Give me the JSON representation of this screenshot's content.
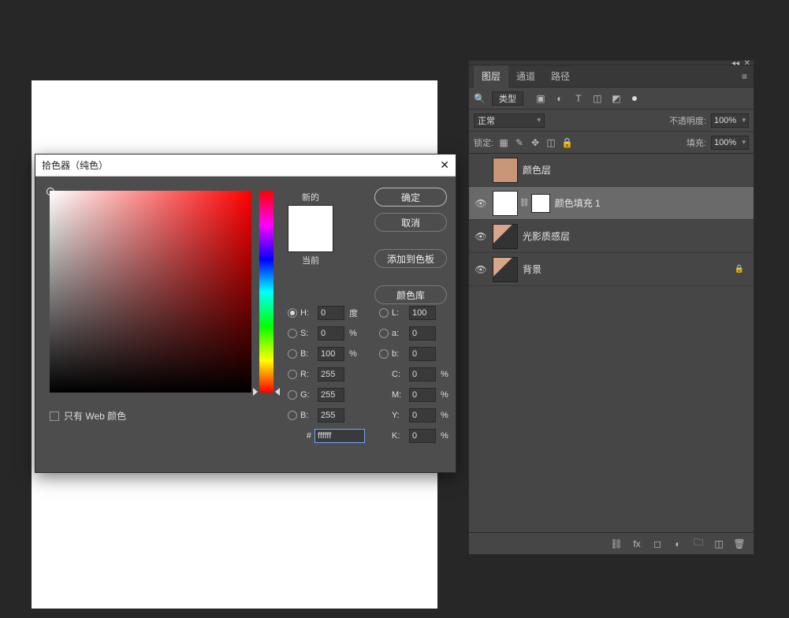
{
  "canvas": {},
  "layers_panel": {
    "tabs": {
      "layers": "图层",
      "channels": "通道",
      "paths": "路径"
    },
    "filter": {
      "search_glyph": "🔍",
      "kind_label": "类型"
    },
    "blend_mode": "正常",
    "opacity_label": "不透明度:",
    "opacity_value": "100%",
    "lock_label": "锁定:",
    "fill_label": "填充:",
    "fill_value": "100%",
    "layers": [
      {
        "name": "颜色层",
        "visible": false,
        "thumb": "tan",
        "locked": false,
        "selected": false
      },
      {
        "name": "颜色填充  1",
        "visible": true,
        "thumb": "white",
        "linked_mask": true,
        "locked": false,
        "selected": true
      },
      {
        "name": "光影质感层",
        "visible": true,
        "thumb": "photo",
        "locked": false,
        "selected": false
      },
      {
        "name": "背景",
        "visible": true,
        "thumb": "photo",
        "locked": true,
        "selected": false
      }
    ]
  },
  "color_picker": {
    "title": "拾色器（纯色）",
    "new_label": "新的",
    "current_label": "当前",
    "buttons": {
      "ok": "确定",
      "cancel": "取消",
      "add_swatch": "添加到色板",
      "libraries": "颜色库"
    },
    "web_only_label": "只有 Web 颜色",
    "hsb": {
      "H_label": "H:",
      "H": "0",
      "H_unit": "度",
      "S_label": "S:",
      "S": "0",
      "S_unit": "%",
      "B_label": "B:",
      "B": "100",
      "B_unit": "%"
    },
    "lab": {
      "L_label": "L:",
      "L": "100",
      "a_label": "a:",
      "a": "0",
      "b_label": "b:",
      "b": "0"
    },
    "rgb": {
      "R_label": "R:",
      "R": "255",
      "G_label": "G:",
      "G": "255",
      "B_label": "B:",
      "B": "255"
    },
    "cmyk": {
      "C_label": "C:",
      "C": "0",
      "C_unit": "%",
      "M_label": "M:",
      "M": "0",
      "M_unit": "%",
      "Y_label": "Y:",
      "Y": "0",
      "Y_unit": "%",
      "K_label": "K:",
      "K": "0",
      "K_unit": "%"
    },
    "hex_label": "#",
    "hex": "ffffff",
    "selected_model": "H"
  }
}
